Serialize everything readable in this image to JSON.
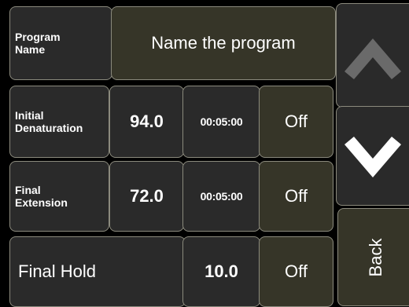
{
  "rows": {
    "program_name": {
      "label_line1": "Program",
      "label_line2": "Name",
      "value": "Name the program"
    },
    "initial_denaturation": {
      "label_line1": "Initial",
      "label_line2": "Denaturation",
      "temp": "94.0",
      "time": "00:05:00",
      "toggle": "Off"
    },
    "final_extension": {
      "label_line1": "Final",
      "label_line2": "Extension",
      "temp": "72.0",
      "time": "00:05:00",
      "toggle": "Off"
    },
    "final_hold": {
      "label": "Final Hold",
      "temp": "10.0",
      "toggle": "Off"
    }
  },
  "side": {
    "up_icon": "chevron-up-icon",
    "down_icon": "chevron-down-icon",
    "back_label": "Back"
  },
  "colors": {
    "background": "#000000",
    "cell_dark": "#2a2a2a",
    "cell_olive": "#363528",
    "border": "#8b8a7d",
    "up_arrow": "#6a6a6a",
    "down_arrow": "#ffffff"
  }
}
